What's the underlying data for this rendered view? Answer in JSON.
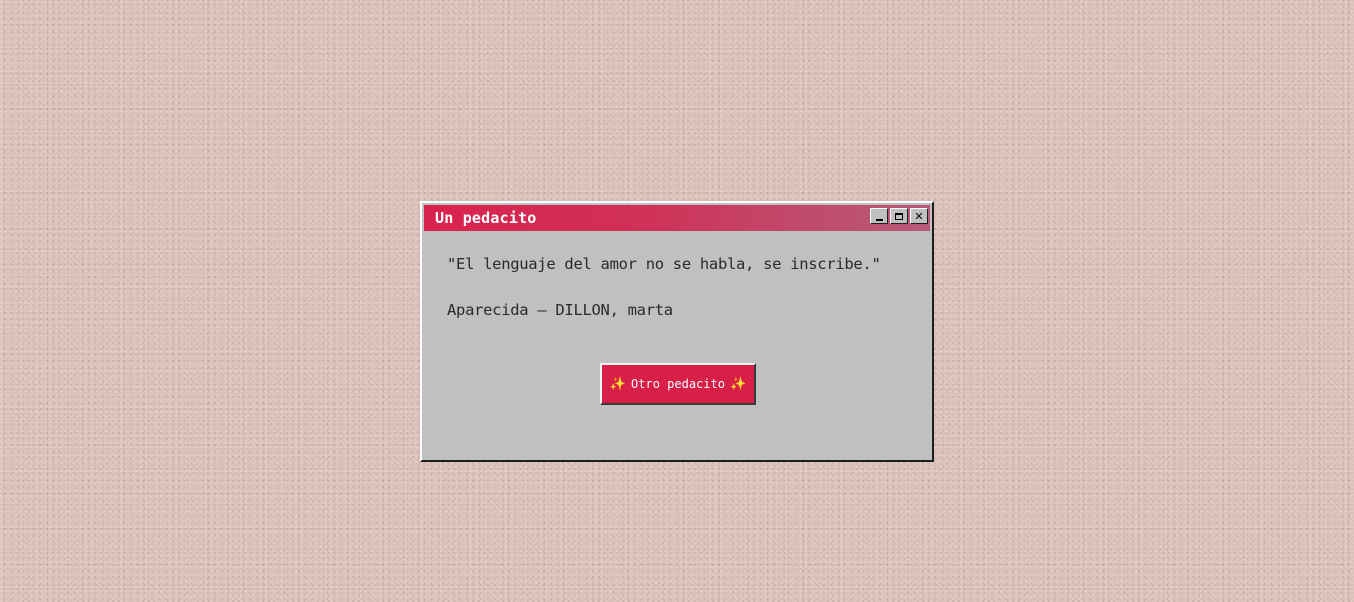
{
  "window": {
    "title": "Un pedacito",
    "controls": {
      "minimize_icon": "minimize-icon",
      "maximize_icon": "maximize-icon",
      "close_icon": "close-icon",
      "close_glyph": "✕"
    }
  },
  "content": {
    "quote": "\"El lenguaje del amor no se habla, se inscribe.\"",
    "source": "Aparecida — DILLON, marta"
  },
  "action_button": {
    "label": "Otro pedacito",
    "sparkle_left": "✨",
    "sparkle_right": "✨"
  },
  "colors": {
    "titlebar_start": "#d9224e",
    "titlebar_end": "#b85a78",
    "window_bg": "#c0c0c0",
    "button_bg": "#d81f48",
    "desktop_bg": "#dcc0bb"
  }
}
